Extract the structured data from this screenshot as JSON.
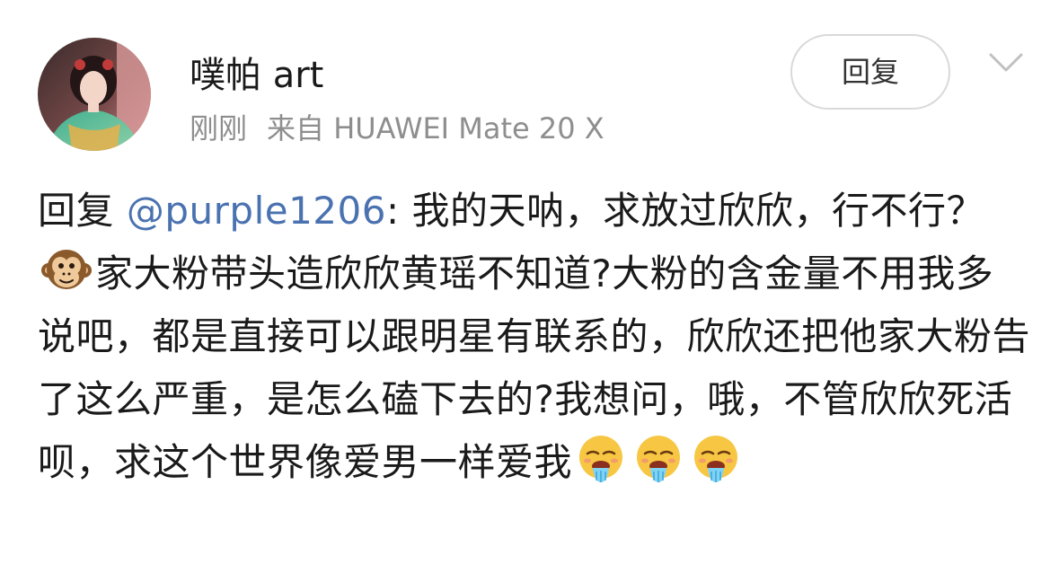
{
  "comment": {
    "username": "噗帕 art",
    "time": "刚刚",
    "source": "来自 HUAWEI Mate 20 X",
    "reply_label": "回复",
    "text_prefix": "回复 ",
    "mention": "@purple1206",
    "text_part1": ": 我的天呐，求放过欣欣，行不行？ ",
    "text_part2": "家大粉带头造欣欣黄瑶不知道?大粉的含金量不用我多说吧，都是直接可以跟明星有联系的，欣欣还把他家大粉告了这么严重，是怎么磕下去的?我想问，哦，不管欣欣死活呗，求这个世界像爱男一样爱我",
    "emojis": {
      "inline": "monkey-face-emoji",
      "trailing": [
        "drooling-face-emoji",
        "drooling-face-emoji",
        "drooling-face-emoji"
      ]
    }
  },
  "colors": {
    "mention": "#4a72b0",
    "meta_text": "#8e8e8e",
    "body_text": "#1a1a1a",
    "button_border": "#d9d9d9"
  }
}
